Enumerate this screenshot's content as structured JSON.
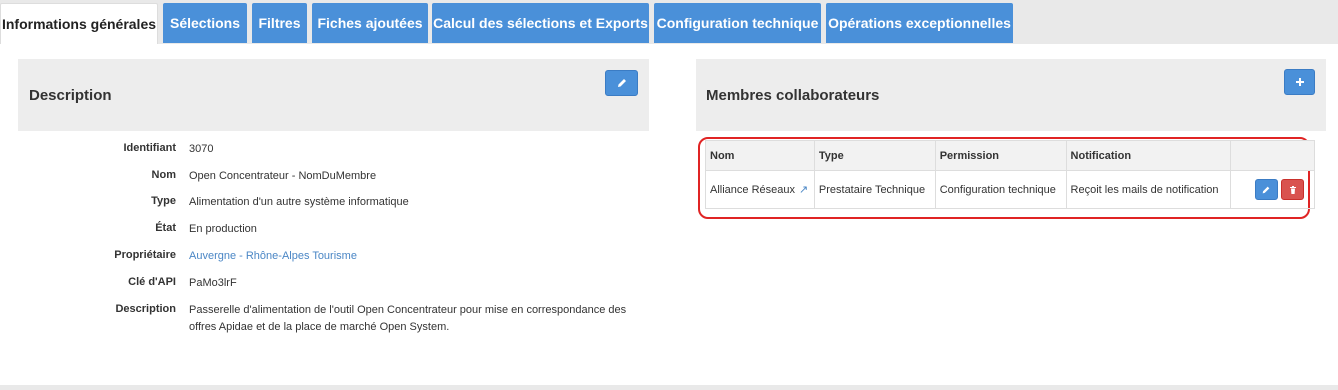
{
  "tabs": [
    {
      "label": "Informations générales",
      "active": true
    },
    {
      "label": "Sélections"
    },
    {
      "label": "Filtres"
    },
    {
      "label": "Fiches ajoutées"
    },
    {
      "label": "Calcul des sélections et Exports"
    },
    {
      "label": "Configuration technique"
    },
    {
      "label": "Opérations exceptionnelles"
    }
  ],
  "description": {
    "title": "Description",
    "fields": [
      {
        "label": "Identifiant",
        "value": "3070"
      },
      {
        "label": "Nom",
        "value": "Open Concentrateur - NomDuMembre"
      },
      {
        "label": "Type",
        "value": "Alimentation d'un autre système informatique"
      },
      {
        "label": "État",
        "value": "En production"
      },
      {
        "label": "Propriétaire",
        "value": "Auvergne - Rhône-Alpes Tourisme"
      },
      {
        "label": "Clé d'API",
        "value": "PaMo3lrF"
      },
      {
        "label": "Description",
        "value": "Passerelle d'alimentation de l'outil Open Concentrateur pour mise en correspondance des offres Apidae et de la place de marché Open System."
      }
    ]
  },
  "members": {
    "title": "Membres collaborateurs",
    "columns": [
      "Nom",
      "Type",
      "Permission",
      "Notification"
    ],
    "rows": [
      {
        "nom": "Alliance Réseaux",
        "type": "Prestataire Technique",
        "permission": "Configuration technique",
        "notification": "Reçoit les mails de notification"
      }
    ]
  },
  "colors": {
    "accent": "#4a90d9",
    "danger": "#d9534f",
    "highlight": "#e02424"
  }
}
